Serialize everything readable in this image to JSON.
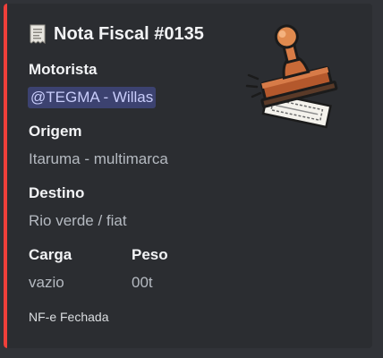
{
  "embed": {
    "accent_color": "#ef3f3a",
    "title_icon": "receipt-icon",
    "title": "Nota Fiscal #0135",
    "thumbnail_icon": "rubber-stamp-icon",
    "fields": {
      "motorista": {
        "name": "Motorista",
        "value": "@TEGMA - Willas"
      },
      "origem": {
        "name": "Origem",
        "value": "Itaruma - multimarca"
      },
      "destino": {
        "name": "Destino",
        "value": "Rio verde / fiat"
      },
      "carga": {
        "name": "Carga",
        "value": "vazio"
      },
      "peso": {
        "name": "Peso",
        "value": "00t"
      }
    },
    "footer": "NF-e Fechada"
  }
}
